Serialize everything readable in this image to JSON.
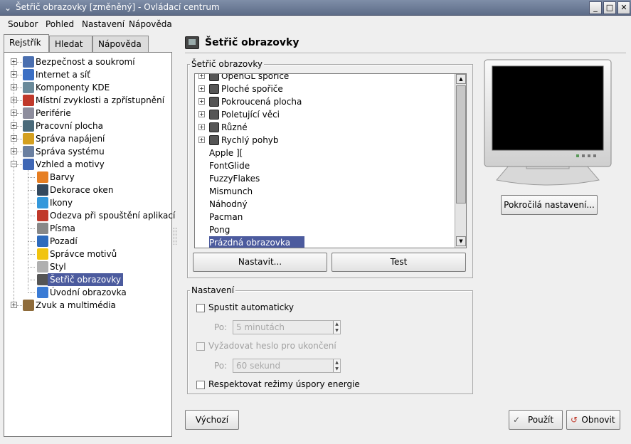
{
  "window": {
    "title": "Šetřič obrazovky [změněný] - Ovládací centrum",
    "menu_icon": "chevron-down-icon",
    "buttons": {
      "minimize": "_",
      "maximize": "□",
      "close": "✕"
    }
  },
  "menubar": {
    "soubor": "Soubor",
    "pohled": "Pohled",
    "nastaveni": "Nastavení",
    "napoveda": "Nápověda"
  },
  "tabs": {
    "rejstrik": "Rejstřík",
    "hledat": "Hledat",
    "napoveda": "Nápověda"
  },
  "tree": {
    "items": [
      {
        "label": "Bezpečnost a soukromí",
        "icon": "lock-icon",
        "color": "#4a6fb0"
      },
      {
        "label": "Internet a síť",
        "icon": "globe-icon",
        "color": "#3b6fc4"
      },
      {
        "label": "Komponenty KDE",
        "icon": "components-icon",
        "color": "#6a8a9a"
      },
      {
        "label": "Místní zvyklosti a zpřístupnění",
        "icon": "flag-icon",
        "color": "#c0392b"
      },
      {
        "label": "Periférie",
        "icon": "mouse-icon",
        "color": "#8d8d9d"
      },
      {
        "label": "Pracovní plocha",
        "icon": "desktop-icon",
        "color": "#4a6a7a"
      },
      {
        "label": "Správa napájení",
        "icon": "battery-icon",
        "color": "#d4a020"
      },
      {
        "label": "Správa systému",
        "icon": "system-icon",
        "color": "#6a7fa0"
      },
      {
        "label": "Vzhled a motivy",
        "icon": "theme-icon",
        "color": "#3f67b5"
      },
      {
        "label": "Barvy",
        "icon": "colors-icon",
        "color": "#e67e22"
      },
      {
        "label": "Dekorace oken",
        "icon": "window-decoration-icon",
        "color": "#34495e"
      },
      {
        "label": "Ikony",
        "icon": "icons-icon",
        "color": "#3498db"
      },
      {
        "label": "Odezva při spouštění aplikací",
        "icon": "launch-feedback-icon",
        "color": "#c0392b"
      },
      {
        "label": "Písma",
        "icon": "fonts-icon",
        "color": "#888888"
      },
      {
        "label": "Pozadí",
        "icon": "background-icon",
        "color": "#2e6bbd"
      },
      {
        "label": "Správce motivů",
        "icon": "theme-manager-icon",
        "color": "#f1c40f"
      },
      {
        "label": "Styl",
        "icon": "style-icon",
        "color": "#b0b0b0"
      },
      {
        "label": "Šetřič obrazovky",
        "icon": "screensaver-icon",
        "color": "#555555"
      },
      {
        "label": "Úvodní obrazovka",
        "icon": "splash-screen-icon",
        "color": "#3a7bd5"
      },
      {
        "label": "Zvuk a multimédia",
        "icon": "sound-icon",
        "color": "#8e6b3a"
      }
    ]
  },
  "header": {
    "title": "Šetřič obrazovky",
    "icon": "screensaver-icon"
  },
  "saver_group": {
    "label": "Šetřič obrazovky",
    "items": [
      {
        "label": "OpenGL spořiče",
        "category": true
      },
      {
        "label": "Ploché spořiče",
        "category": true
      },
      {
        "label": "Pokroucená plocha",
        "category": true
      },
      {
        "label": "Poletující věci",
        "category": true
      },
      {
        "label": "Různé",
        "category": true
      },
      {
        "label": "Rychlý pohyb",
        "category": true
      },
      {
        "label": "Apple ][",
        "category": false
      },
      {
        "label": "FontGlide",
        "category": false
      },
      {
        "label": "FuzzyFlakes",
        "category": false
      },
      {
        "label": "Mismunch",
        "category": false
      },
      {
        "label": "Náhodný",
        "category": false
      },
      {
        "label": "Pacman",
        "category": false
      },
      {
        "label": "Pong",
        "category": false
      },
      {
        "label": "Prázdná obrazovka",
        "category": false,
        "selected": true
      }
    ],
    "setup_button": "Nastavit...",
    "test_button": "Test"
  },
  "advanced_button": "Pokročilá nastavení...",
  "settings_group": {
    "label": "Nastavení",
    "auto_start": "Spustit automaticky",
    "after_label": "Po:",
    "after_value": "5 minutách",
    "require_password": "Vyžadovat heslo pro ukončení",
    "pw_after_label": "Po:",
    "pw_after_value": "60 sekund",
    "respect_power": "Respektovat režimy úspory energie"
  },
  "footer": {
    "default_button": "Výchozí",
    "apply_button": "Použít",
    "reset_button": "Obnovit"
  }
}
